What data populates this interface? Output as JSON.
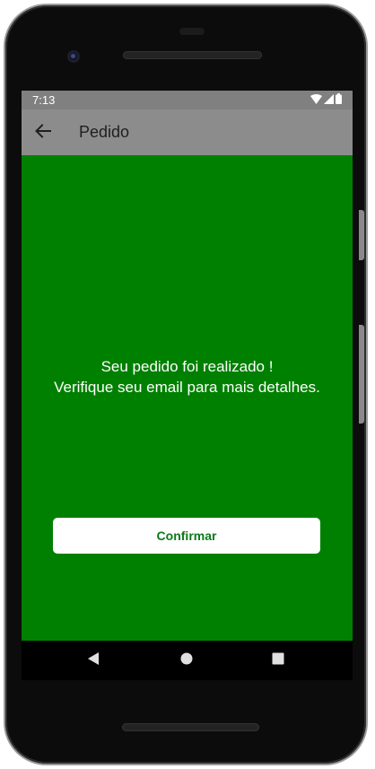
{
  "status_bar": {
    "time": "7:13",
    "icons": [
      "wifi-icon",
      "signal-icon",
      "battery-icon"
    ]
  },
  "app_bar": {
    "title": "Pedido",
    "back_icon": "arrow-left-icon"
  },
  "message": {
    "line1": "Seu pedido foi realizado !",
    "line2": "Verifique seu email para mais detalhes."
  },
  "confirm_button": {
    "label": "Confirmar"
  },
  "nav_bar": {
    "icons": [
      "triangle-back-icon",
      "circle-home-icon",
      "square-recents-icon"
    ]
  },
  "colors": {
    "screen_background": "#008000",
    "app_bar": "#8c8c8c",
    "status_bar": "#808080",
    "button_text": "#0a7a1a"
  }
}
